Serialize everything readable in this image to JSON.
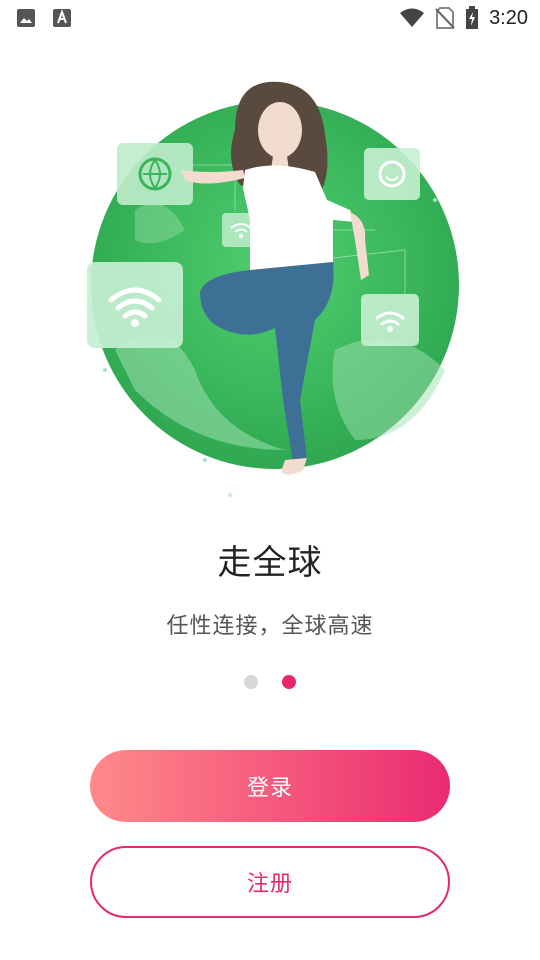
{
  "status_bar": {
    "time": "3:20",
    "icons": [
      "image-icon",
      "font-icon",
      "wifi-icon",
      "no-sim-icon",
      "battery-charging-icon"
    ]
  },
  "onboarding": {
    "title": "走全球",
    "subtitle": "任性连接，全球高速",
    "page_count": 2,
    "active_page": 2
  },
  "buttons": {
    "login_label": "登录",
    "register_label": "注册"
  },
  "colors": {
    "accent": "#e8276e",
    "gradient_start": "#ff8a8a",
    "gradient_end": "#ea2b72",
    "globe_green": "#3fbf63"
  }
}
